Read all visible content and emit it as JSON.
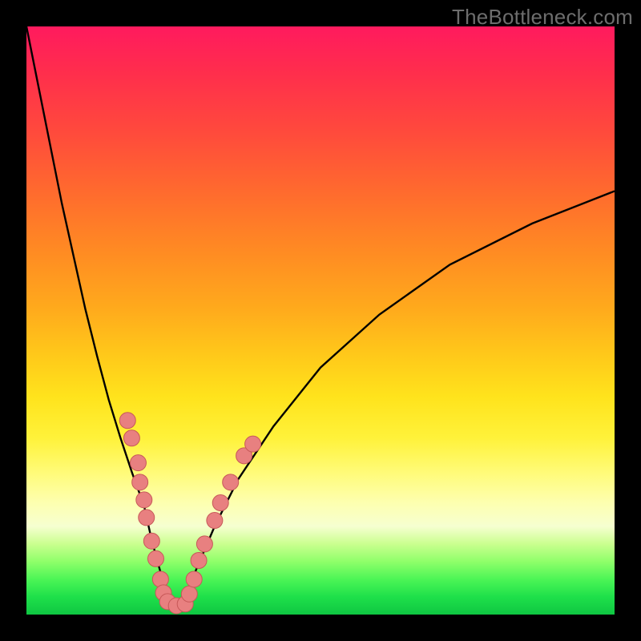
{
  "watermark": "TheBottleneck.com",
  "chart_data": {
    "type": "line",
    "title": "",
    "xlabel": "",
    "ylabel": "",
    "xlim": [
      0,
      100
    ],
    "ylim": [
      0,
      100
    ],
    "series": [
      {
        "name": "curve",
        "x": [
          0,
          2,
          4,
          6,
          8,
          10,
          12,
          14,
          16,
          18,
          20,
          21,
          22,
          23,
          24,
          25.5,
          27,
          29,
          32,
          36,
          42,
          50,
          60,
          72,
          86,
          100
        ],
        "values": [
          100,
          90,
          80,
          70,
          61,
          52,
          44,
          36.5,
          30,
          24,
          18.5,
          14,
          10,
          6.5,
          3.5,
          1.2,
          3,
          8,
          15,
          23,
          32,
          42,
          51,
          59.5,
          66.5,
          72
        ]
      }
    ],
    "markers": [
      {
        "x": 17.2,
        "y": 33.0
      },
      {
        "x": 17.9,
        "y": 30.0
      },
      {
        "x": 19.0,
        "y": 25.8
      },
      {
        "x": 19.3,
        "y": 22.5
      },
      {
        "x": 20.0,
        "y": 19.5
      },
      {
        "x": 20.4,
        "y": 16.5
      },
      {
        "x": 21.3,
        "y": 12.5
      },
      {
        "x": 22.0,
        "y": 9.5
      },
      {
        "x": 22.8,
        "y": 6.0
      },
      {
        "x": 23.3,
        "y": 3.7
      },
      {
        "x": 24.0,
        "y": 2.2
      },
      {
        "x": 25.5,
        "y": 1.5
      },
      {
        "x": 27.0,
        "y": 1.8
      },
      {
        "x": 27.7,
        "y": 3.5
      },
      {
        "x": 28.5,
        "y": 6.0
      },
      {
        "x": 29.3,
        "y": 9.2
      },
      {
        "x": 30.3,
        "y": 12.0
      },
      {
        "x": 32.0,
        "y": 16.0
      },
      {
        "x": 33.0,
        "y": 19.0
      },
      {
        "x": 34.7,
        "y": 22.5
      },
      {
        "x": 37.0,
        "y": 27.0
      },
      {
        "x": 38.5,
        "y": 29.0
      }
    ],
    "marker_style": {
      "fill": "#e88080",
      "stroke": "#c75858",
      "radius_px": 10
    },
    "gradient_stops": [
      {
        "pos": 0,
        "color": "#ff1a5e"
      },
      {
        "pos": 50,
        "color": "#ffc91a"
      },
      {
        "pos": 80,
        "color": "#fdffb0"
      },
      {
        "pos": 100,
        "color": "#0fc642"
      }
    ]
  }
}
